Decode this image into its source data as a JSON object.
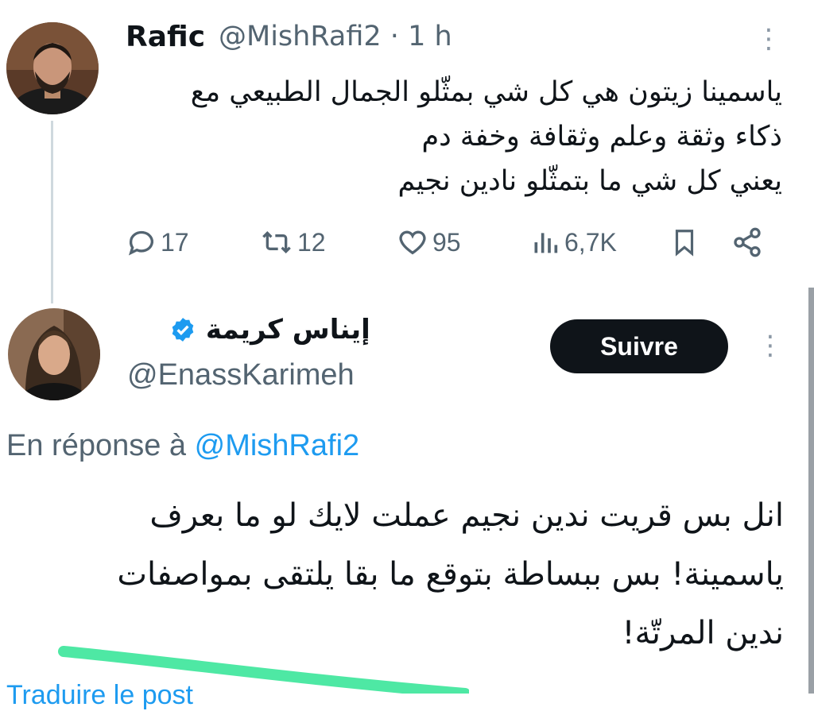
{
  "tweet1": {
    "author_name": "Rafic",
    "handle": "@MishRafi2",
    "separator": "·",
    "time": "1 h",
    "lines": [
      "ياسمينا زيتون هي كل شي بمثّلو الجمال الطبيعي مع",
      "ذكاء وثقة وعلم وثقافة وخفة دم",
      "يعني كل شي ما بتمثّلو  نادين نجيم"
    ],
    "actions": {
      "replies": "17",
      "retweets": "12",
      "likes": "95",
      "views": "6,7K"
    }
  },
  "tweet2": {
    "author_name": "إيناس كريمة",
    "handle": "@EnassKarimeh",
    "follow_label": "Suivre",
    "reply_prefix": "En réponse à",
    "reply_to": "@MishRafi2",
    "lines": [
      "انل بس قريت ندين نجيم عملت لايك لو ما بعرف",
      "ياسمينة! بس ببساطة بتوقع ما بقا يلتقى بمواصفات",
      "ندين المرتّة!"
    ],
    "cut_text": "Traduire le post"
  },
  "icons": {
    "reply": "reply-icon",
    "retweet": "retweet-icon",
    "like": "heart-icon",
    "views": "views-icon",
    "bookmark": "bookmark-icon",
    "share": "share-icon",
    "verified": "verified-badge-icon",
    "more": "more-icon"
  },
  "colors": {
    "accent": "#1d9bf0",
    "muted": "#536471",
    "highlight_stroke": "#4ee8a4"
  }
}
